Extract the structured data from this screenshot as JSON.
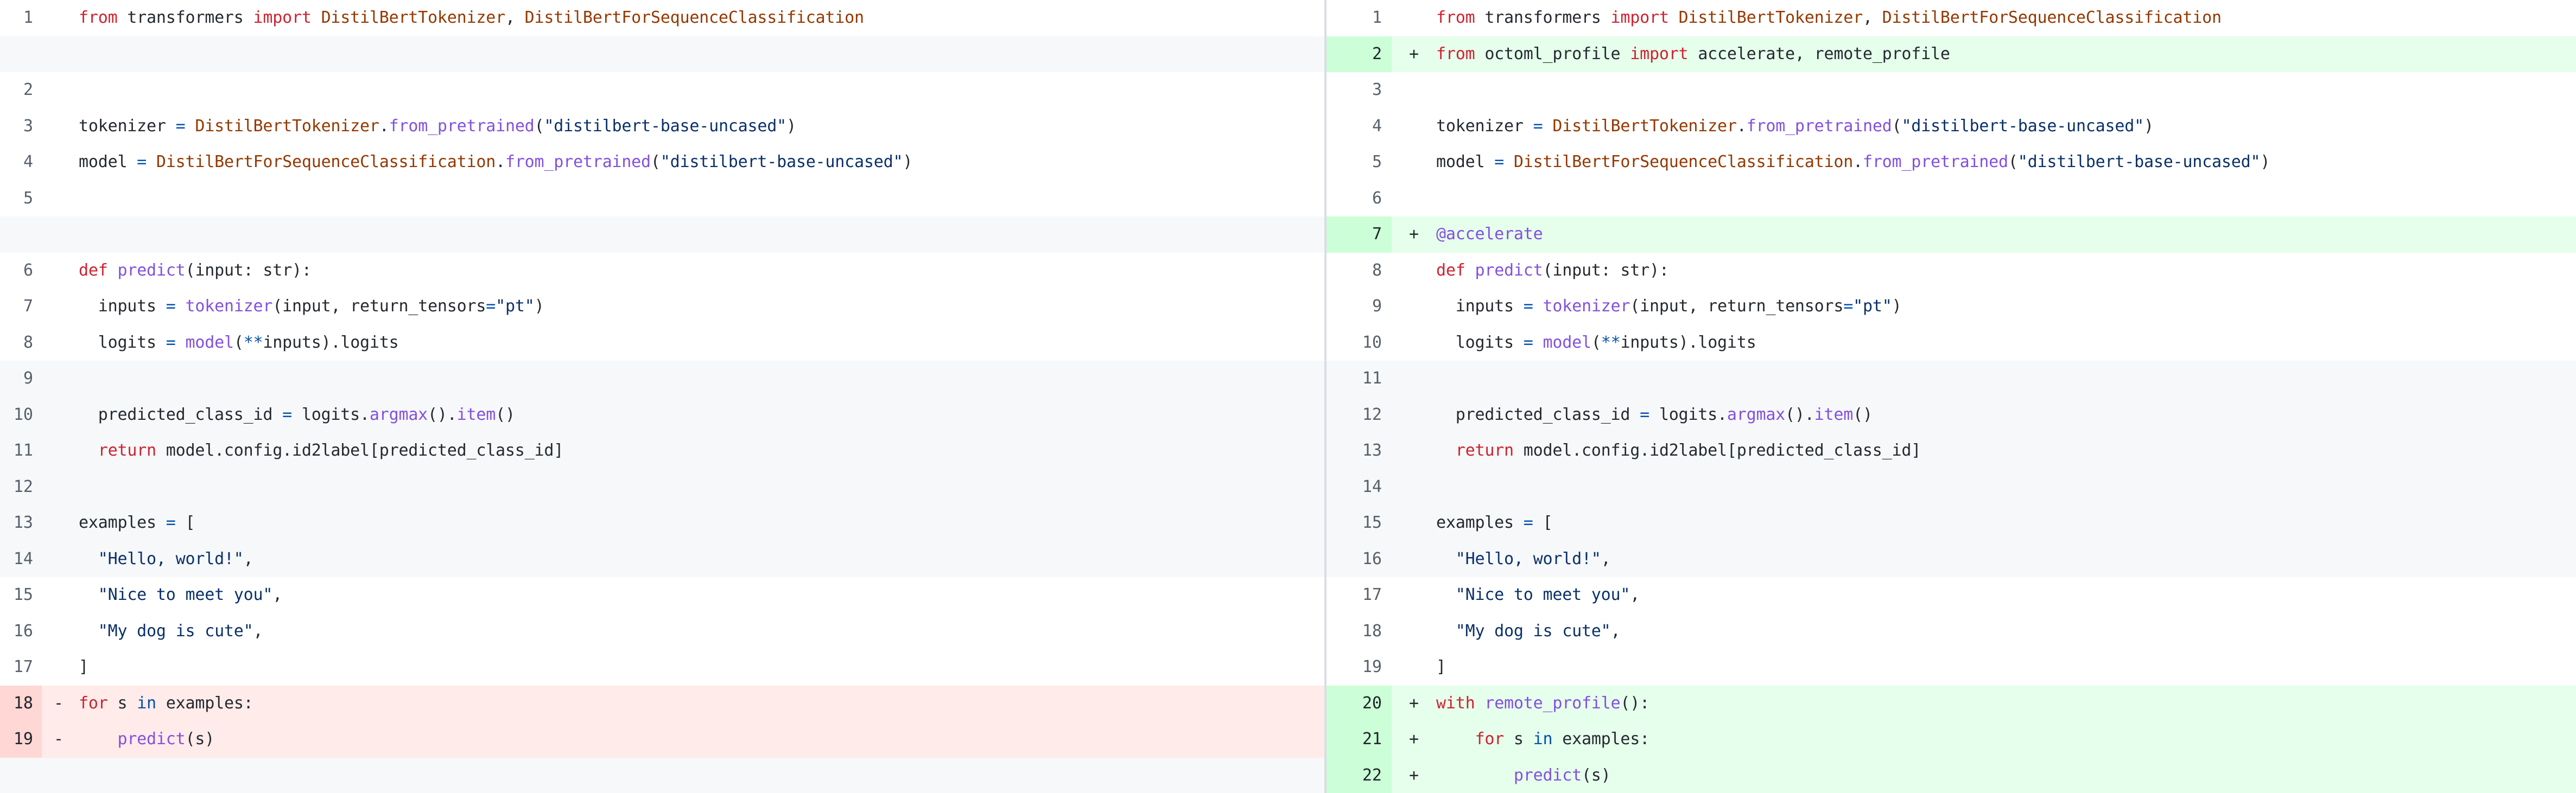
{
  "view": {
    "type": "split-diff",
    "language": "python",
    "left_title": "original",
    "right_title": "modified"
  },
  "colors": {
    "keyword": "#cf222e",
    "class": "#953800",
    "function": "#8250df",
    "string": "#0a3069",
    "operator": "#0550ae",
    "plain": "#24292f",
    "line_number": "#57606a",
    "add_bg": "#e6ffec",
    "add_gutter_bg": "#ccffd8",
    "del_bg": "#ffebe9",
    "del_gutter_bg": "#ffd7d5",
    "hunk_bg": "#f6f8fa",
    "divider": "#d8dee4"
  },
  "left": {
    "rows": [
      {
        "num": "1",
        "marker": "",
        "type": "ctx",
        "tokens": [
          {
            "t": "from",
            "c": "k"
          },
          {
            "t": " transformers ",
            "c": "p"
          },
          {
            "t": "import",
            "c": "k"
          },
          {
            "t": " ",
            "c": "p"
          },
          {
            "t": "DistilBertTokenizer",
            "c": "c"
          },
          {
            "t": ", ",
            "c": "p"
          },
          {
            "t": "DistilBertForSequenceClassification",
            "c": "c"
          }
        ]
      },
      {
        "num": "",
        "marker": "",
        "type": "empty hunk",
        "tokens": []
      },
      {
        "num": "2",
        "marker": "",
        "type": "ctx",
        "tokens": []
      },
      {
        "num": "3",
        "marker": "",
        "type": "ctx",
        "tokens": [
          {
            "t": "tokenizer ",
            "c": "p"
          },
          {
            "t": "=",
            "c": "o"
          },
          {
            "t": " ",
            "c": "p"
          },
          {
            "t": "DistilBertTokenizer",
            "c": "c"
          },
          {
            "t": ".",
            "c": "p"
          },
          {
            "t": "from_pretrained",
            "c": "f"
          },
          {
            "t": "(",
            "c": "p"
          },
          {
            "t": "\"distilbert-base-uncased\"",
            "c": "s"
          },
          {
            "t": ")",
            "c": "p"
          }
        ]
      },
      {
        "num": "4",
        "marker": "",
        "type": "ctx",
        "tokens": [
          {
            "t": "model ",
            "c": "p"
          },
          {
            "t": "=",
            "c": "o"
          },
          {
            "t": " ",
            "c": "p"
          },
          {
            "t": "DistilBertForSequenceClassification",
            "c": "c"
          },
          {
            "t": ".",
            "c": "p"
          },
          {
            "t": "from_pretrained",
            "c": "f"
          },
          {
            "t": "(",
            "c": "p"
          },
          {
            "t": "\"distilbert-base-uncased\"",
            "c": "s"
          },
          {
            "t": ")",
            "c": "p"
          }
        ]
      },
      {
        "num": "5",
        "marker": "",
        "type": "ctx",
        "tokens": []
      },
      {
        "num": "",
        "marker": "",
        "type": "empty hunk",
        "tokens": []
      },
      {
        "num": "6",
        "marker": "",
        "type": "ctx",
        "tokens": [
          {
            "t": "def",
            "c": "k"
          },
          {
            "t": " ",
            "c": "p"
          },
          {
            "t": "predict",
            "c": "f"
          },
          {
            "t": "(input: str):",
            "c": "p"
          }
        ]
      },
      {
        "num": "7",
        "marker": "",
        "type": "ctx",
        "tokens": [
          {
            "t": "  inputs ",
            "c": "p"
          },
          {
            "t": "=",
            "c": "o"
          },
          {
            "t": " ",
            "c": "p"
          },
          {
            "t": "tokenizer",
            "c": "f"
          },
          {
            "t": "(input, return_tensors",
            "c": "p"
          },
          {
            "t": "=",
            "c": "o"
          },
          {
            "t": "\"pt\"",
            "c": "s"
          },
          {
            "t": ")",
            "c": "p"
          }
        ]
      },
      {
        "num": "8",
        "marker": "",
        "type": "ctx",
        "tokens": [
          {
            "t": "  logits ",
            "c": "p"
          },
          {
            "t": "=",
            "c": "o"
          },
          {
            "t": " ",
            "c": "p"
          },
          {
            "t": "model",
            "c": "f"
          },
          {
            "t": "(",
            "c": "p"
          },
          {
            "t": "**",
            "c": "o"
          },
          {
            "t": "inputs).logits",
            "c": "p"
          }
        ]
      },
      {
        "num": "9",
        "marker": "",
        "type": "hunk",
        "tokens": []
      },
      {
        "num": "10",
        "marker": "",
        "type": "hunk",
        "tokens": [
          {
            "t": "  predicted_class_id ",
            "c": "p"
          },
          {
            "t": "=",
            "c": "o"
          },
          {
            "t": " logits.",
            "c": "p"
          },
          {
            "t": "argmax",
            "c": "f"
          },
          {
            "t": "().",
            "c": "p"
          },
          {
            "t": "item",
            "c": "f"
          },
          {
            "t": "()",
            "c": "p"
          }
        ]
      },
      {
        "num": "11",
        "marker": "",
        "type": "hunk",
        "tokens": [
          {
            "t": "  ",
            "c": "p"
          },
          {
            "t": "return",
            "c": "k"
          },
          {
            "t": " model.config.id2label[predicted_class_id]",
            "c": "p"
          }
        ]
      },
      {
        "num": "12",
        "marker": "",
        "type": "hunk",
        "tokens": []
      },
      {
        "num": "13",
        "marker": "",
        "type": "hunk",
        "tokens": [
          {
            "t": "examples ",
            "c": "p"
          },
          {
            "t": "=",
            "c": "o"
          },
          {
            "t": " [",
            "c": "p"
          }
        ]
      },
      {
        "num": "14",
        "marker": "",
        "type": "hunk",
        "tokens": [
          {
            "t": "  ",
            "c": "p"
          },
          {
            "t": "\"Hello, world!\"",
            "c": "s"
          },
          {
            "t": ",",
            "c": "p"
          }
        ]
      },
      {
        "num": "15",
        "marker": "",
        "type": "ctx",
        "tokens": [
          {
            "t": "  ",
            "c": "p"
          },
          {
            "t": "\"Nice to meet you\"",
            "c": "s"
          },
          {
            "t": ",",
            "c": "p"
          }
        ]
      },
      {
        "num": "16",
        "marker": "",
        "type": "ctx",
        "tokens": [
          {
            "t": "  ",
            "c": "p"
          },
          {
            "t": "\"My dog is cute\"",
            "c": "s"
          },
          {
            "t": ",",
            "c": "p"
          }
        ]
      },
      {
        "num": "17",
        "marker": "",
        "type": "ctx",
        "tokens": [
          {
            "t": "]",
            "c": "p"
          }
        ]
      },
      {
        "num": "18",
        "marker": "-",
        "type": "del",
        "tokens": [
          {
            "t": "for",
            "c": "k"
          },
          {
            "t": " s ",
            "c": "p"
          },
          {
            "t": "in",
            "c": "o"
          },
          {
            "t": " examples:",
            "c": "p"
          }
        ]
      },
      {
        "num": "19",
        "marker": "-",
        "type": "del",
        "tokens": [
          {
            "t": "    ",
            "c": "p"
          },
          {
            "t": "predict",
            "c": "f"
          },
          {
            "t": "(s)",
            "c": "p"
          }
        ]
      },
      {
        "num": "",
        "marker": "",
        "type": "empty hunk",
        "tokens": []
      }
    ]
  },
  "right": {
    "rows": [
      {
        "num": "1",
        "marker": "",
        "type": "ctx",
        "tokens": [
          {
            "t": "from",
            "c": "k"
          },
          {
            "t": " transformers ",
            "c": "p"
          },
          {
            "t": "import",
            "c": "k"
          },
          {
            "t": " ",
            "c": "p"
          },
          {
            "t": "DistilBertTokenizer",
            "c": "c"
          },
          {
            "t": ", ",
            "c": "p"
          },
          {
            "t": "DistilBertForSequenceClassification",
            "c": "c"
          }
        ]
      },
      {
        "num": "2",
        "marker": "+",
        "type": "add",
        "tokens": [
          {
            "t": "from",
            "c": "k"
          },
          {
            "t": " octoml_profile ",
            "c": "p"
          },
          {
            "t": "import",
            "c": "k"
          },
          {
            "t": " accelerate, remote_profile",
            "c": "p"
          }
        ]
      },
      {
        "num": "3",
        "marker": "",
        "type": "ctx",
        "tokens": []
      },
      {
        "num": "4",
        "marker": "",
        "type": "ctx",
        "tokens": [
          {
            "t": "tokenizer ",
            "c": "p"
          },
          {
            "t": "=",
            "c": "o"
          },
          {
            "t": " ",
            "c": "p"
          },
          {
            "t": "DistilBertTokenizer",
            "c": "c"
          },
          {
            "t": ".",
            "c": "p"
          },
          {
            "t": "from_pretrained",
            "c": "f"
          },
          {
            "t": "(",
            "c": "p"
          },
          {
            "t": "\"distilbert-base-uncased\"",
            "c": "s"
          },
          {
            "t": ")",
            "c": "p"
          }
        ]
      },
      {
        "num": "5",
        "marker": "",
        "type": "ctx",
        "tokens": [
          {
            "t": "model ",
            "c": "p"
          },
          {
            "t": "=",
            "c": "o"
          },
          {
            "t": " ",
            "c": "p"
          },
          {
            "t": "DistilBertForSequenceClassification",
            "c": "c"
          },
          {
            "t": ".",
            "c": "p"
          },
          {
            "t": "from_pretrained",
            "c": "f"
          },
          {
            "t": "(",
            "c": "p"
          },
          {
            "t": "\"distilbert-base-uncased\"",
            "c": "s"
          },
          {
            "t": ")",
            "c": "p"
          }
        ]
      },
      {
        "num": "6",
        "marker": "",
        "type": "ctx",
        "tokens": []
      },
      {
        "num": "7",
        "marker": "+",
        "type": "add",
        "tokens": [
          {
            "t": "@accelerate",
            "c": "f"
          }
        ]
      },
      {
        "num": "8",
        "marker": "",
        "type": "ctx",
        "tokens": [
          {
            "t": "def",
            "c": "k"
          },
          {
            "t": " ",
            "c": "p"
          },
          {
            "t": "predict",
            "c": "f"
          },
          {
            "t": "(input: str):",
            "c": "p"
          }
        ]
      },
      {
        "num": "9",
        "marker": "",
        "type": "ctx",
        "tokens": [
          {
            "t": "  inputs ",
            "c": "p"
          },
          {
            "t": "=",
            "c": "o"
          },
          {
            "t": " ",
            "c": "p"
          },
          {
            "t": "tokenizer",
            "c": "f"
          },
          {
            "t": "(input, return_tensors",
            "c": "p"
          },
          {
            "t": "=",
            "c": "o"
          },
          {
            "t": "\"pt\"",
            "c": "s"
          },
          {
            "t": ")",
            "c": "p"
          }
        ]
      },
      {
        "num": "10",
        "marker": "",
        "type": "ctx",
        "tokens": [
          {
            "t": "  logits ",
            "c": "p"
          },
          {
            "t": "=",
            "c": "o"
          },
          {
            "t": " ",
            "c": "p"
          },
          {
            "t": "model",
            "c": "f"
          },
          {
            "t": "(",
            "c": "p"
          },
          {
            "t": "**",
            "c": "o"
          },
          {
            "t": "inputs).logits",
            "c": "p"
          }
        ]
      },
      {
        "num": "11",
        "marker": "",
        "type": "hunk",
        "tokens": []
      },
      {
        "num": "12",
        "marker": "",
        "type": "hunk",
        "tokens": [
          {
            "t": "  predicted_class_id ",
            "c": "p"
          },
          {
            "t": "=",
            "c": "o"
          },
          {
            "t": " logits.",
            "c": "p"
          },
          {
            "t": "argmax",
            "c": "f"
          },
          {
            "t": "().",
            "c": "p"
          },
          {
            "t": "item",
            "c": "f"
          },
          {
            "t": "()",
            "c": "p"
          }
        ]
      },
      {
        "num": "13",
        "marker": "",
        "type": "hunk",
        "tokens": [
          {
            "t": "  ",
            "c": "p"
          },
          {
            "t": "return",
            "c": "k"
          },
          {
            "t": " model.config.id2label[predicted_class_id]",
            "c": "p"
          }
        ]
      },
      {
        "num": "14",
        "marker": "",
        "type": "hunk",
        "tokens": []
      },
      {
        "num": "15",
        "marker": "",
        "type": "hunk",
        "tokens": [
          {
            "t": "examples ",
            "c": "p"
          },
          {
            "t": "=",
            "c": "o"
          },
          {
            "t": " [",
            "c": "p"
          }
        ]
      },
      {
        "num": "16",
        "marker": "",
        "type": "hunk",
        "tokens": [
          {
            "t": "  ",
            "c": "p"
          },
          {
            "t": "\"Hello, world!\"",
            "c": "s"
          },
          {
            "t": ",",
            "c": "p"
          }
        ]
      },
      {
        "num": "17",
        "marker": "",
        "type": "ctx",
        "tokens": [
          {
            "t": "  ",
            "c": "p"
          },
          {
            "t": "\"Nice to meet you\"",
            "c": "s"
          },
          {
            "t": ",",
            "c": "p"
          }
        ]
      },
      {
        "num": "18",
        "marker": "",
        "type": "ctx",
        "tokens": [
          {
            "t": "  ",
            "c": "p"
          },
          {
            "t": "\"My dog is cute\"",
            "c": "s"
          },
          {
            "t": ",",
            "c": "p"
          }
        ]
      },
      {
        "num": "19",
        "marker": "",
        "type": "ctx",
        "tokens": [
          {
            "t": "]",
            "c": "p"
          }
        ]
      },
      {
        "num": "20",
        "marker": "+",
        "type": "add",
        "tokens": [
          {
            "t": "with",
            "c": "k"
          },
          {
            "t": " ",
            "c": "p"
          },
          {
            "t": "remote_profile",
            "c": "f"
          },
          {
            "t": "():",
            "c": "p"
          }
        ]
      },
      {
        "num": "21",
        "marker": "+",
        "type": "add",
        "tokens": [
          {
            "t": "    ",
            "c": "p"
          },
          {
            "t": "for",
            "c": "k"
          },
          {
            "t": " s ",
            "c": "p"
          },
          {
            "t": "in",
            "c": "o"
          },
          {
            "t": " examples:",
            "c": "p"
          }
        ]
      },
      {
        "num": "22",
        "marker": "+",
        "type": "add",
        "tokens": [
          {
            "t": "        ",
            "c": "p"
          },
          {
            "t": "predict",
            "c": "f"
          },
          {
            "t": "(s)",
            "c": "p"
          }
        ]
      }
    ]
  }
}
